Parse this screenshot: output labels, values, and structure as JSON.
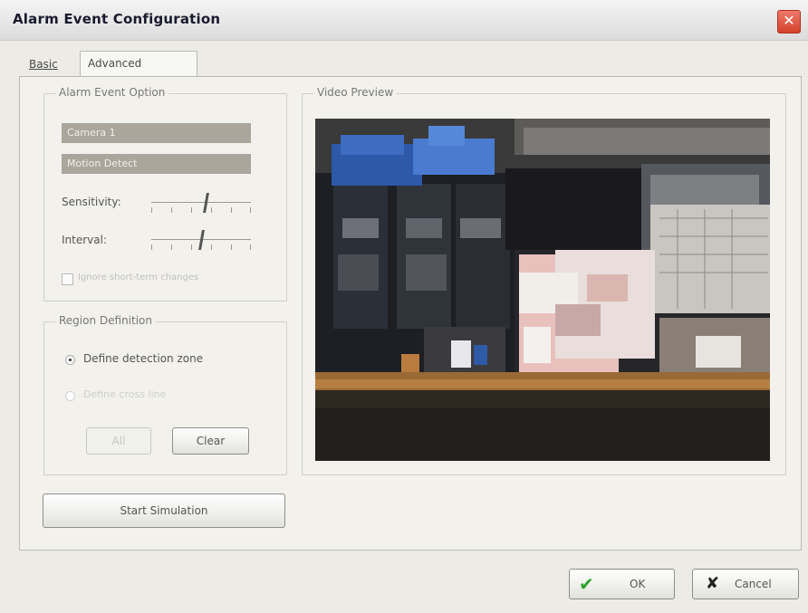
{
  "window": {
    "title": "Alarm Event Configuration",
    "close_symbol": "✕"
  },
  "tabs": [
    {
      "label": "Basic"
    },
    {
      "label": "Advanced"
    }
  ],
  "alarm_event_option": {
    "legend": "Alarm Event Option",
    "camera_field": "Camera 1",
    "event_field": "Motion Detect",
    "sensitivity_label": "Sensitivity:",
    "sensitivity_level": 0.55,
    "interval_label": "Interval:",
    "interval_level": 0.5,
    "checkbox_label": "Ignore short-term changes",
    "checkbox_checked": false
  },
  "region_definition": {
    "legend": "Region Definition",
    "option_define_zone": "Define detection zone",
    "option_define_zone_selected": true,
    "option_define_line": "Define cross line",
    "all_button": "All",
    "clear_button": "Clear"
  },
  "start_simulation_button": "Start Simulation",
  "video_preview": {
    "legend": "Video Preview"
  },
  "footer": {
    "ok_label": "OK",
    "cancel_label": "Cancel",
    "ok_icon": "✔",
    "cancel_icon": "✘"
  },
  "colors": {
    "accent_green": "#27a327",
    "close_red": "#d3412c",
    "disabled_bar": "#aaa69c"
  }
}
